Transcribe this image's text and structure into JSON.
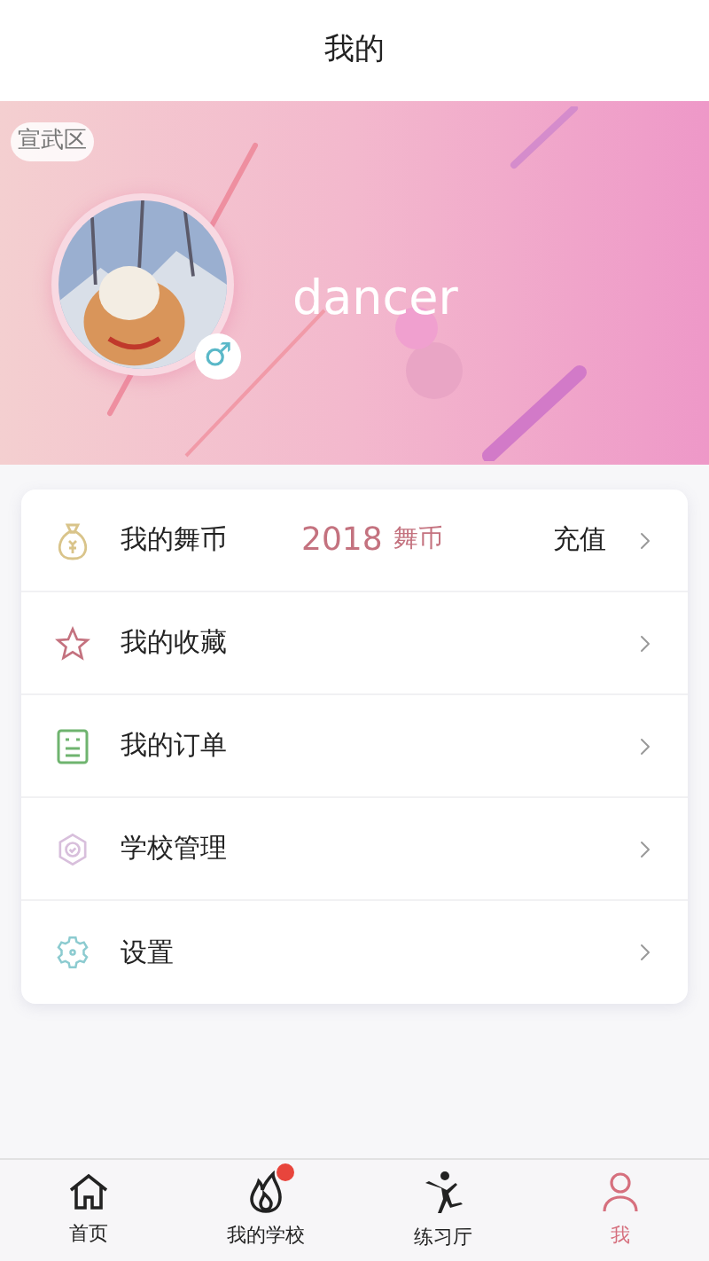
{
  "header": {
    "title": "我的"
  },
  "profile": {
    "district": "宣武区",
    "username": "dancer",
    "gender_symbol": "♂"
  },
  "menu": [
    {
      "kind": "coins",
      "label": "我的舞币",
      "amount": "2018",
      "unit": "舞币",
      "action": "充值"
    },
    {
      "kind": "favorites",
      "label": "我的收藏"
    },
    {
      "kind": "orders",
      "label": "我的订单"
    },
    {
      "kind": "school",
      "label": "学校管理"
    },
    {
      "kind": "settings",
      "label": "设置"
    }
  ],
  "tab_bar": [
    {
      "kind": "home",
      "label": "首页",
      "selected": false,
      "badge": false
    },
    {
      "kind": "school",
      "label": "我的学校",
      "selected": false,
      "badge": true
    },
    {
      "kind": "practice",
      "label": "练习厅",
      "selected": false,
      "badge": false
    },
    {
      "kind": "me",
      "label": "我",
      "selected": true,
      "badge": false
    }
  ]
}
